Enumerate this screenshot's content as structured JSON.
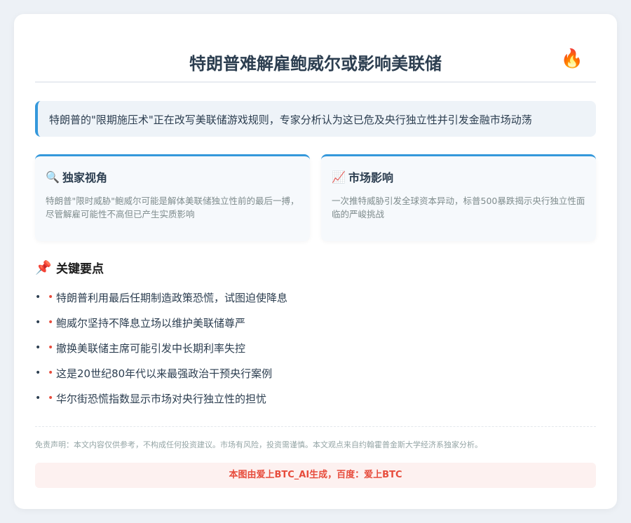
{
  "header": {
    "title": "特朗普难解雇鲍威尔或影响美联储",
    "icon": "fire-icon"
  },
  "summary": {
    "text": "特朗普的\"限期施压术\"正在改写美联储游戏规则，专家分析认为这已危及央行独立性并引发金融市场动荡",
    "accent_color": "#3498db"
  },
  "panels": [
    {
      "icon": "magnifier-icon",
      "title": "独家视角",
      "text": "特朗普\"限时威胁\"鲍威尔可能是解体美联储独立性前的最后一搏，尽管解雇可能性不高但已产生实质影响"
    },
    {
      "icon": "chart-increasing-icon",
      "title": "市场影响",
      "text": "一次推特威胁引发全球资本异动，标普500暴跌揭示央行独立性面临的严峻挑战"
    }
  ],
  "key_points": {
    "icon": "pushpin-icon",
    "title": "关键要点",
    "bullet": "•",
    "items": [
      "特朗普利用最后任期制造政策恐慌，试图迫使降息",
      "鲍威尔坚持不降息立场以维护美联储尊严",
      "撤换美联储主席可能引发中长期利率失控",
      "这是20世纪80年代以来最强政治干预央行案例",
      "华尔街恐慌指数显示市场对央行独立性的担忧"
    ]
  },
  "disclaimer": "免责声明：本文内容仅供参考，不构成任何投资建议。市场有风险，投资需谨慎。本文观点来自约翰霍普金斯大学经济系独家分析。",
  "footer": {
    "text": "本图由爱上BTC_AI生成，百度：爱上BTC",
    "color": "#e74c3c"
  }
}
